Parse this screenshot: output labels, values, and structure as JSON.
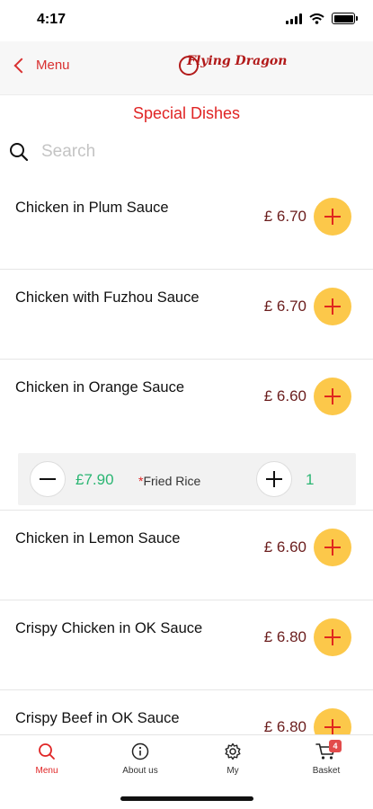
{
  "status": {
    "time": "4:17"
  },
  "nav": {
    "back_label": "Menu",
    "logo_text": "Flying Dragon"
  },
  "section_title": "Special Dishes",
  "search": {
    "placeholder": "Search"
  },
  "dishes": [
    {
      "name": "Chicken in Plum Sauce",
      "price": "£ 6.70"
    },
    {
      "name": "Chicken with Fuzhou Sauce",
      "price": "£ 6.70"
    },
    {
      "name": "Chicken in Orange Sauce",
      "price": "£ 6.60"
    },
    {
      "name": "Chicken in Lemon Sauce",
      "price": "£ 6.60"
    },
    {
      "name": "Crispy Chicken in OK Sauce",
      "price": "£ 6.80"
    },
    {
      "name": "Crispy Beef in OK Sauce",
      "price": "£ 6.80"
    }
  ],
  "option": {
    "price": "£7.90",
    "required_mark": "*",
    "label": "Fried Rice",
    "quantity": "1"
  },
  "tabs": [
    {
      "label": "Menu",
      "icon": "search-icon",
      "active": true
    },
    {
      "label": "About us",
      "icon": "info-icon"
    },
    {
      "label": "My",
      "icon": "gear-icon"
    },
    {
      "label": "Basket",
      "icon": "cart-icon",
      "badge": "4"
    }
  ],
  "colors": {
    "accent": "#e02424",
    "add_button": "#fcc84a",
    "price": "#6b1d1d",
    "option_green": "#2bb673"
  }
}
